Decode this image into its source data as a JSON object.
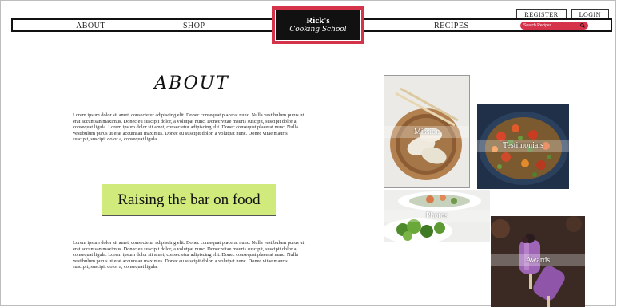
{
  "header": {
    "register_label": "REGISTER",
    "login_label": "LOGIN",
    "nav": {
      "about": "ABOUT",
      "shop": "SHOP",
      "recipes": "RECIPES"
    },
    "logo": {
      "title": "Rick's",
      "subtitle": "Cooking School"
    },
    "search": {
      "placeholder": "Search Recipes..."
    }
  },
  "main": {
    "title": "ABOUT",
    "paragraph1": "Lorem ipsum dolor sit amet, consectetur adipiscing elit. Donec consequat placerat nunc. Nulla vestibulum purus ut erat accumsan maximus. Donec eu suscipit dolor, a volutpat nunc. Donec vitae mauris suscipit, suscipit dolor a, consequat ligula. Lorem ipsum dolor sit amet, consectetur adipiscing elit. Donec consequat placerat nunc. Nulla vestibulum purus ut erat accumsan maximus. Donec eu suscipit dolor, a volutpat nunc. Donec vitae mauris suscipit, suscipit dolor a, consequat ligula.",
    "banner": "Raising the bar on food",
    "paragraph2": "Lorem ipsum dolor sit amet, consectetur adipiscing elit. Donec consequat placerat nunc. Nulla vestibulum purus ut erat accumsan maximus. Donec eu suscipit dolor, a volutpat nunc. Donec vitae mauris suscipit, suscipit dolor a, consequat ligula. Lorem ipsum dolor sit amet, consectetur adipiscing elit. Donec consequat placerat nunc. Nulla vestibulum purus ut erat accumsan maximus. Donec eu suscipit dolor, a volutpat nunc. Donec vitae mauris suscipit, suscipit dolor a, consequat ligula."
  },
  "tiles": {
    "mission": "Mission",
    "testimonials": "Testimonials",
    "photos": "Photos",
    "awards": "Awards"
  },
  "colors": {
    "accent": "#d4334a",
    "banner": "#d0ea7c"
  }
}
